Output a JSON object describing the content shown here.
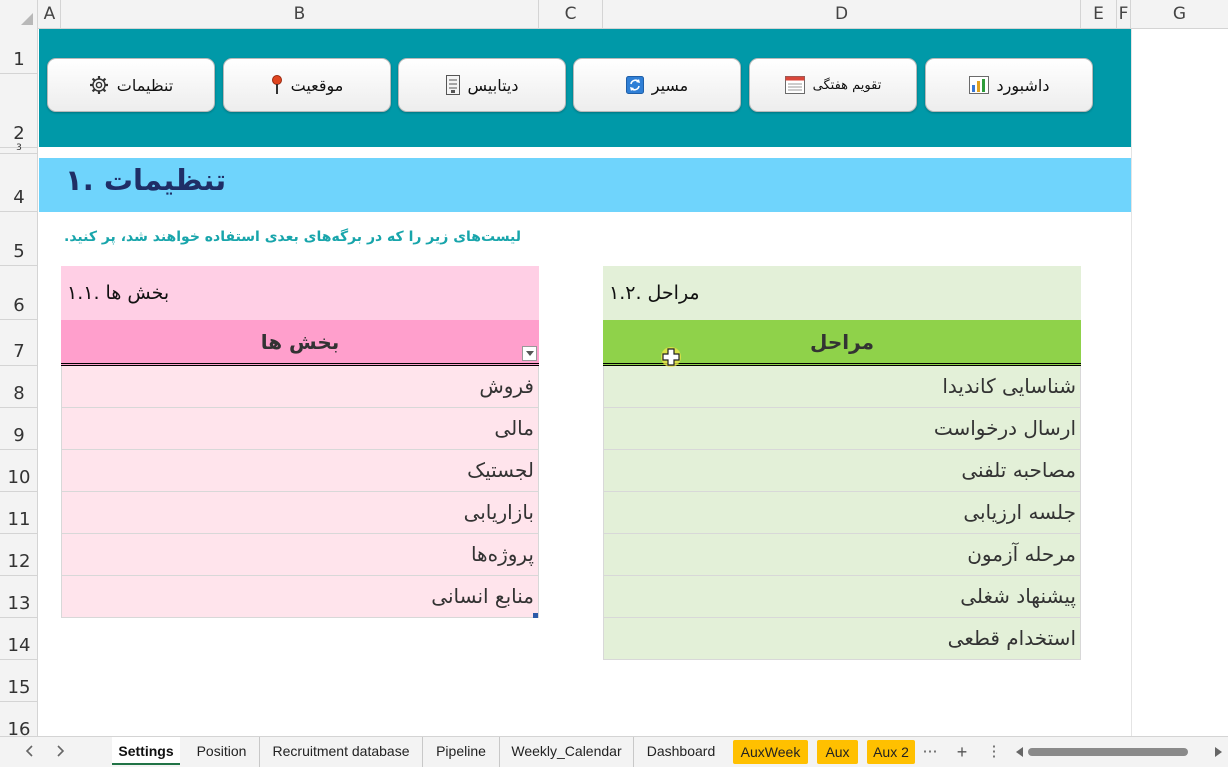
{
  "columns": [
    "A",
    "B",
    "C",
    "D",
    "E",
    "F",
    "G"
  ],
  "rows": [
    "1",
    "2",
    "3",
    "4",
    "5",
    "6",
    "7",
    "8",
    "9",
    "10",
    "11",
    "12",
    "13",
    "14",
    "15",
    "16"
  ],
  "nav_buttons": [
    {
      "label": "داشبورد",
      "icon": "bar-chart-icon"
    },
    {
      "label": "تقویم هفتگی",
      "icon": "calendar-icon"
    },
    {
      "label": "مسیر",
      "icon": "refresh-icon"
    },
    {
      "label": "دیتابیس",
      "icon": "database-icon"
    },
    {
      "label": "موقعیت",
      "icon": "location-pin-icon"
    },
    {
      "label": "تنظیمات",
      "icon": "gear-icon"
    }
  ],
  "title": "تنظیمات .۱",
  "subtitle": "لیست‌های زیر را که در برگه‌های بعدی استفاده خواهند شد، پر کنید.",
  "departments": {
    "title": "بخش ها .۱.۱",
    "header": "بخش ها",
    "items": [
      "فروش",
      "مالی",
      "لجستیک",
      "بازاریابی",
      "پروژه‌ها",
      "منابع انسانی"
    ]
  },
  "stages": {
    "title": "مراحل .۱.۲",
    "header": "مراحل",
    "items": [
      "شناسایی کاندیدا",
      "ارسال درخواست",
      "مصاحبه تلفنی",
      "جلسه ارزیابی",
      "مرحله آزمون",
      "پیشنهاد شغلی",
      "استخدام قطعی"
    ]
  },
  "sheet_tabs": [
    {
      "label": "Settings",
      "active": true
    },
    {
      "label": "Position"
    },
    {
      "label": "Recruitment database"
    },
    {
      "label": "Pipeline"
    },
    {
      "label": "Weekly_Calendar"
    },
    {
      "label": "Dashboard"
    },
    {
      "label": "AuxWeek",
      "color": "#ffc000"
    },
    {
      "label": "Aux",
      "color": "#ffc000"
    },
    {
      "label": "Aux 2",
      "color": "#ffc000"
    }
  ],
  "tabbar_controls": {
    "more": "⋯",
    "add": "+",
    "options": "⋮"
  },
  "colors": {
    "nav_band": "#0099a8",
    "title_band": "#6fd4fc",
    "title_text": "#1f2e66",
    "subtitle_text": "#18a5ab",
    "dept_header": "#ff9fcc",
    "dept_body": "#ffe4ec",
    "stage_header": "#8fd24a",
    "stage_body": "#e3f0d8",
    "aux_tab": "#ffc000"
  }
}
